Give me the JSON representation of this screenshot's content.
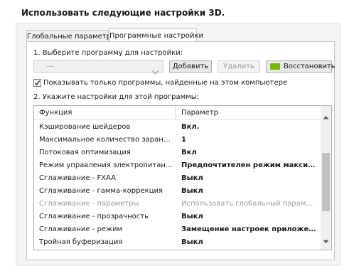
{
  "header": {
    "title": "Использовать следующие настройки 3D."
  },
  "tabs": [
    {
      "label": "Глобальные параметры"
    },
    {
      "label": "Программные настройки"
    }
  ],
  "step1": {
    "label": "1. Выберите программу для настройки:",
    "program_select": {
      "value": "..."
    },
    "add_label": "Добавить",
    "remove_label": "Удалить",
    "restore_label": "Восстановить"
  },
  "filter_checkbox": {
    "label": "Показывать только программы, найденные на этом компьютере",
    "checked": true
  },
  "step2": {
    "label": "2. Укажите настройки для этой программы:",
    "columns": {
      "feature": "Функция",
      "setting": "Параметр"
    },
    "rows": [
      {
        "feature": "Кэширование шейдеров",
        "setting": "Вкл."
      },
      {
        "feature": "Максимальное количество заранее под...",
        "setting": "1"
      },
      {
        "feature": "Потоковая оптимизация",
        "setting": "Вкл"
      },
      {
        "feature": "Режим управления электропитанием",
        "setting": "Предпочтителен режим максимал..."
      },
      {
        "feature": "Сглаживание - FXAA",
        "setting": "Выкл"
      },
      {
        "feature": "Сглаживание - гамма-коррекция",
        "setting": "Выкл"
      },
      {
        "feature": "Сглаживание - параметры",
        "setting": "Использовать глобальный параметр (У...",
        "disabled": true
      },
      {
        "feature": "Сглаживание - прозрачность",
        "setting": "Выкл"
      },
      {
        "feature": "Сглаживание - режим",
        "setting": "Замещение настроек приложения"
      },
      {
        "feature": "Тройная буферизация",
        "setting": "Выкл"
      }
    ]
  },
  "colors": {
    "brand_green": "#76b900"
  }
}
